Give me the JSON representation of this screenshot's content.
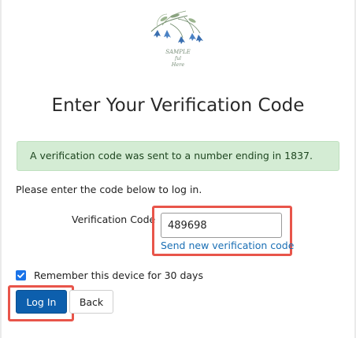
{
  "logo": {
    "lines": [
      "SAMPLE",
      "ful",
      "Here"
    ],
    "icon": "bluebell-flowers-logo"
  },
  "page": {
    "title": "Enter Your Verification Code"
  },
  "alert": {
    "message": "A verification code was sent to a number ending in 1837.",
    "color": "#d4ecd4"
  },
  "form": {
    "instruction": "Please enter the code below to log in.",
    "code_label": "Verification Code",
    "code_value": "489698",
    "resend_link": "Send new verification code",
    "remember_label": "Remember this device for 30 days",
    "remember_checked": true
  },
  "buttons": {
    "login": "Log In",
    "back": "Back"
  },
  "colors": {
    "primary": "#0d5fad",
    "link": "#1a6fb5",
    "highlight": "#e8554a",
    "checkbox": "#1a73e8"
  }
}
